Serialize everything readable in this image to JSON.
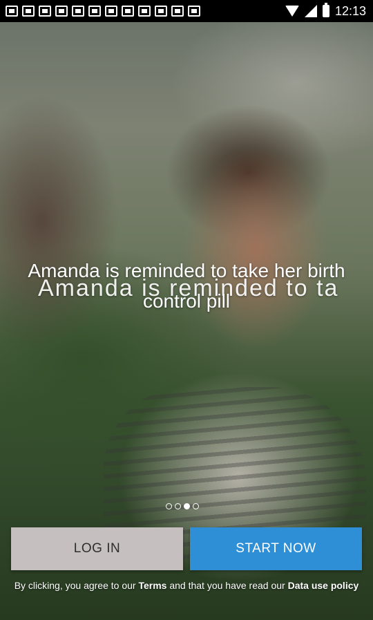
{
  "status_bar": {
    "notification_icons": [
      "notification-icon",
      "notification-icon",
      "notification-icon",
      "notification-icon",
      "notification-icon",
      "notification-icon",
      "notification-icon",
      "notification-icon",
      "notification-icon",
      "notification-icon",
      "notification-icon",
      "notification-icon"
    ],
    "time": "12:13"
  },
  "slide": {
    "caption": "Amanda is reminded to take her birth control pill",
    "caption_transition_ghost": "Amanda is reminded to ta"
  },
  "pager": {
    "count": 4,
    "active_index": 2
  },
  "actions": {
    "login_label": "LOG IN",
    "start_label": "START NOW"
  },
  "legal": {
    "prefix": "By clicking, you agree to our ",
    "terms_link": "Terms",
    "middle": " and that you have read our ",
    "policy_link": "Data use policy"
  },
  "colors": {
    "login_bg": "#c5c0bf",
    "start_bg": "#2f8fd6"
  }
}
